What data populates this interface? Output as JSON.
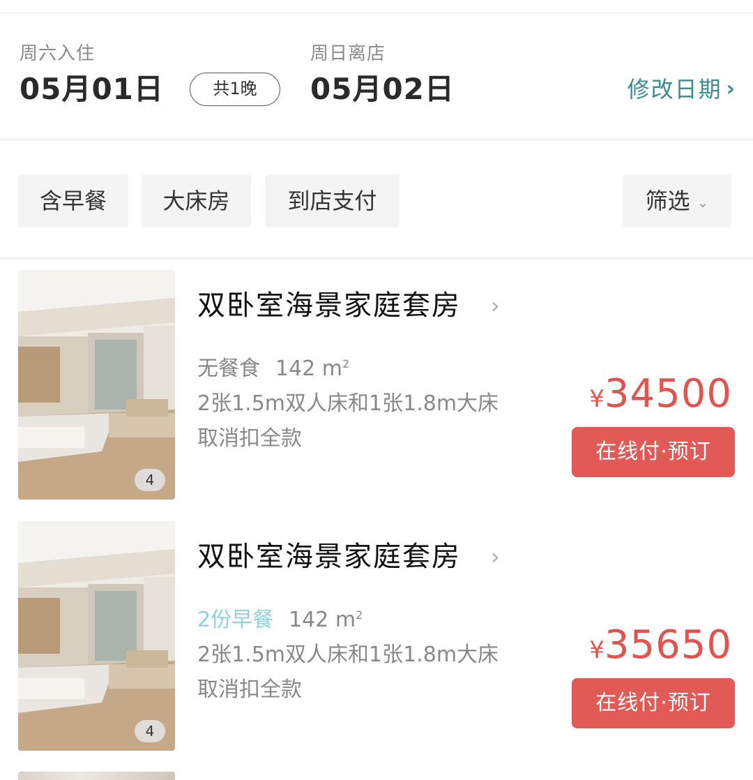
{
  "dates": {
    "checkin_label": "周六入住",
    "checkin_date": "05月01日",
    "nights": "共1晚",
    "checkout_label": "周日离店",
    "checkout_date": "05月02日",
    "modify_label": "修改日期",
    "modify_icon": "chevron-right-icon"
  },
  "filters": {
    "chips": [
      "含早餐",
      "大床房",
      "到店支付"
    ],
    "filter_label": "筛选",
    "filter_icon": "chevron-down-icon"
  },
  "rooms": [
    {
      "name": "双卧室海景家庭套房",
      "meal": "无餐食",
      "meal_highlight": false,
      "area": "142 m",
      "area_unit": "2",
      "beds": "2张1.5m双人床和1张1.8m大床",
      "cancel_policy": "取消扣全款",
      "currency": "¥",
      "price": "34500",
      "book_label": "在线付·预订",
      "photo_count": "4"
    },
    {
      "name": "双卧室海景家庭套房",
      "meal": "2份早餐",
      "meal_highlight": true,
      "area": "142 m",
      "area_unit": "2",
      "beds": "2张1.5m双人床和1张1.8m大床",
      "cancel_policy": "取消扣全款",
      "currency": "¥",
      "price": "35650",
      "book_label": "在线付·预订",
      "photo_count": "4"
    }
  ],
  "colors": {
    "accent_teal": "#3a8a8e",
    "price_red": "#e0534e",
    "button_red": "#e15a55",
    "breakfast_highlight": "#8fd1dc"
  }
}
